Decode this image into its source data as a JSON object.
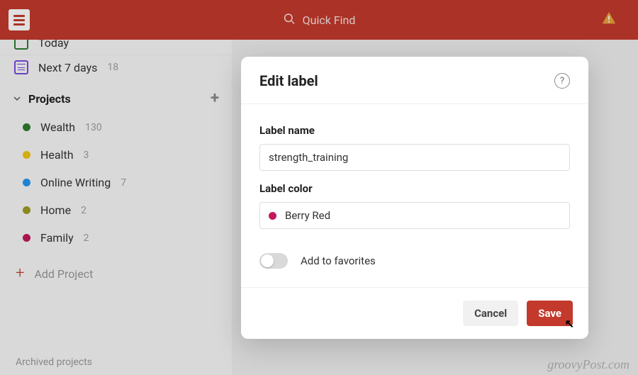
{
  "header": {
    "search_placeholder": "Quick Find"
  },
  "sidebar": {
    "today": {
      "label": "Today"
    },
    "next7": {
      "label": "Next 7 days",
      "count": "18"
    },
    "projects_header": "Projects",
    "projects": [
      {
        "label": "Wealth",
        "count": "130",
        "color": "#2e7d32"
      },
      {
        "label": "Health",
        "count": "3",
        "color": "#f1c40f"
      },
      {
        "label": "Online Writing",
        "count": "7",
        "color": "#2196f3"
      },
      {
        "label": "Home",
        "count": "2",
        "color": "#9e9d24"
      },
      {
        "label": "Family",
        "count": "2",
        "color": "#c2185b"
      }
    ],
    "add_project": "Add Project",
    "archived": "Archived projects"
  },
  "modal": {
    "title": "Edit label",
    "label_name_label": "Label name",
    "label_name_value": "strength_training",
    "label_color_label": "Label color",
    "label_color_value": "Berry Red",
    "label_color_hex": "#c2185b",
    "favorites_label": "Add to favorites",
    "favorites_on": false,
    "cancel": "Cancel",
    "save": "Save"
  },
  "watermark": "groovyPost.com"
}
